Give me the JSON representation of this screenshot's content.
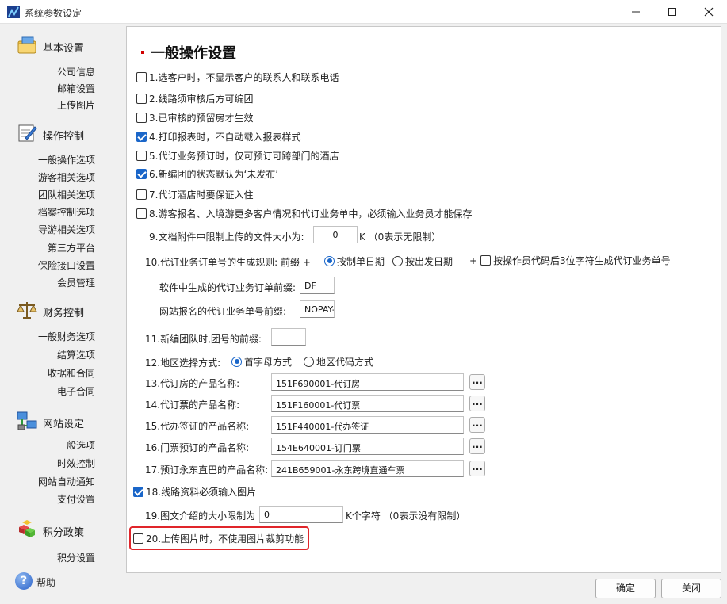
{
  "window": {
    "title": "系统参数设定",
    "accent": "#1a66c9"
  },
  "sidebar": {
    "categories": [
      {
        "label": "基本设置",
        "icon": "folder-icon",
        "items": [
          "公司信息",
          "邮箱设置",
          "上传图片"
        ]
      },
      {
        "label": "操作控制",
        "icon": "edit-document-icon",
        "items": [
          "一般操作选项",
          "游客相关选项",
          "团队相关选项",
          "档案控制选项",
          "导游相关选项",
          "第三方平台",
          "保险接口设置",
          "会员管理"
        ]
      },
      {
        "label": "财务控制",
        "icon": "scales-icon",
        "items": [
          "一般财务选项",
          "结算选项",
          "收据和合同",
          "电子合同"
        ]
      },
      {
        "label": "网站设定",
        "icon": "network-computers-icon",
        "items": [
          "一般选项",
          "时效控制",
          "网站自动通知",
          "支付设置"
        ]
      },
      {
        "label": "积分政策",
        "icon": "cubes-icon",
        "items": [
          "积分设置"
        ]
      }
    ],
    "help": {
      "label": "帮助",
      "icon": "help-icon",
      "glyph": "?"
    }
  },
  "main": {
    "title": "一般操作设置",
    "options": [
      {
        "label": "1.选客户时，不显示客户的联系人和联系电话",
        "checked": false
      },
      {
        "label": "2.线路须审核后方可编团",
        "checked": false
      },
      {
        "label": "3.已审核的预留房才生效",
        "checked": false
      },
      {
        "label": "4.打印报表时，不自动载入报表样式",
        "checked": true
      },
      {
        "label": "5.代订业务预订时，仅可预订可跨部门的酒店",
        "checked": false
      },
      {
        "label": "6.新编团的状态默认为‘未发布’",
        "checked": true
      },
      {
        "label": "7.代订酒店时要保证入住",
        "checked": false
      },
      {
        "label": "8.游客报名、入境游更多客户情况和代订业务单中，必须输入业务员才能保存",
        "checked": false
      }
    ],
    "opt9": {
      "label": "9.文档附件中限制上传的文件大小为:",
      "value": "0",
      "suffix": "K （0表示无限制）"
    },
    "opt10": {
      "label": "10.代订业务订单号的生成规则: 前缀 +",
      "radio1": "按制单日期",
      "radio2": "按出发日期",
      "plus": "+",
      "checkbox": "按操作员代码后3位字符生成代订业务单号",
      "prefix_soft_label": "软件中生成的代订业务订单前缀:",
      "prefix_soft_value": "DF",
      "prefix_web_label": "网站报名的代订业务单号前缀:",
      "prefix_web_value": "NOPAY-"
    },
    "opt11": {
      "label": "11.新编团队时,团号的前缀:",
      "value": ""
    },
    "opt12": {
      "label": "12.地区选择方式:",
      "radio1": "首字母方式",
      "radio2": "地区代码方式"
    },
    "products": [
      {
        "label": "13.代订房的产品名称:",
        "value": "151F690001-代订房"
      },
      {
        "label": "14.代订票的产品名称:",
        "value": "151F160001-代订票"
      },
      {
        "label": "15.代办签证的产品名称:",
        "value": "151F440001-代办签证"
      },
      {
        "label": "16.门票预订的产品名称:",
        "value": "154E640001-订门票"
      },
      {
        "label": "17.预订永东直巴的产品名称:",
        "value": "241B659001-永东跨境直通车票"
      }
    ],
    "browse_label": "...",
    "opt18": {
      "label": "18.线路资料必须输入图片",
      "checked": true
    },
    "opt19": {
      "label": "19.图文介绍的大小限制为",
      "value": "0",
      "suffix": "K个字符 （0表示没有限制）"
    },
    "opt20": {
      "label": "20.上传图片时，不使用图片裁剪功能",
      "checked": false
    }
  },
  "buttons": {
    "ok": "确定",
    "close": "关闭"
  }
}
